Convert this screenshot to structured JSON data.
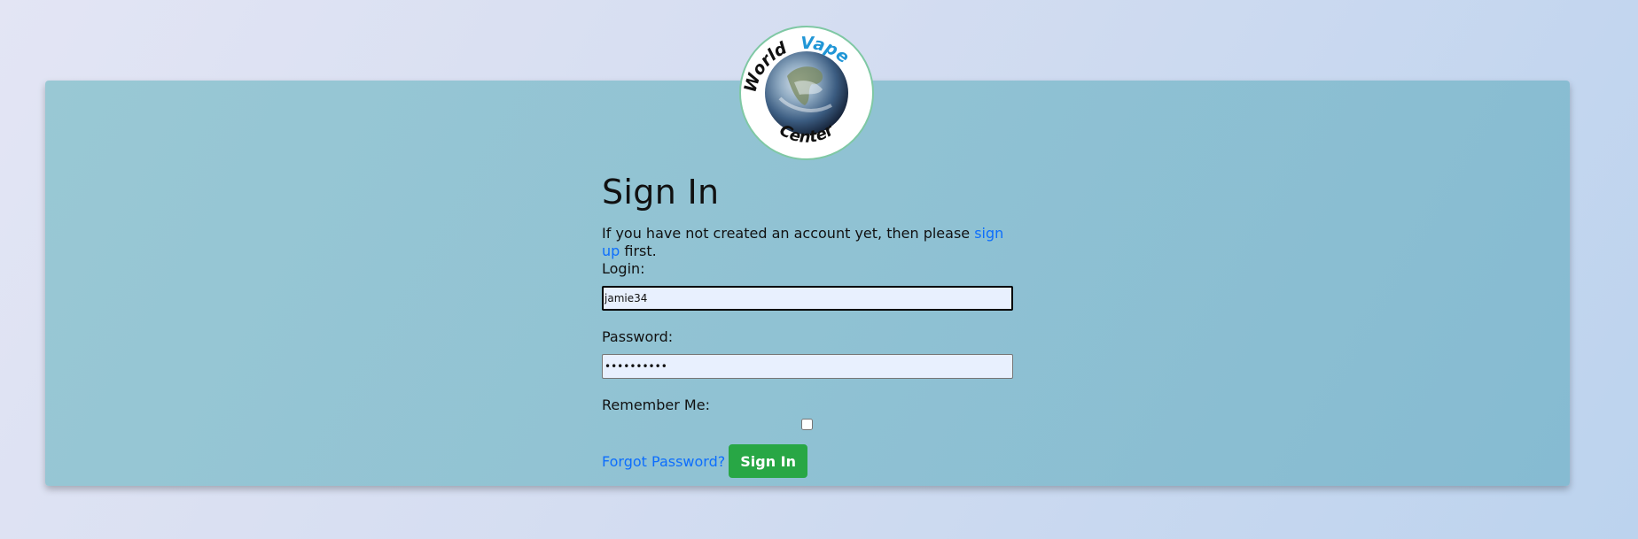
{
  "logo": {
    "top_word": "World",
    "accent_word": "Vape",
    "bottom_word": "Center",
    "accent_color": "#2196d6"
  },
  "signin": {
    "title": "Sign In",
    "intro_before": "If you have not created an account yet, then please ",
    "intro_link": "sign up",
    "intro_after": " first.",
    "login_label": "Login:",
    "login_value": "jamie34",
    "password_label": "Password:",
    "password_value": "••••••••••",
    "remember_label": "Remember Me:",
    "remember_checked": false,
    "forgot_link": "Forgot Password?",
    "submit_label": "Sign In"
  },
  "colors": {
    "link": "#0d6efd",
    "button": "#28a745"
  }
}
